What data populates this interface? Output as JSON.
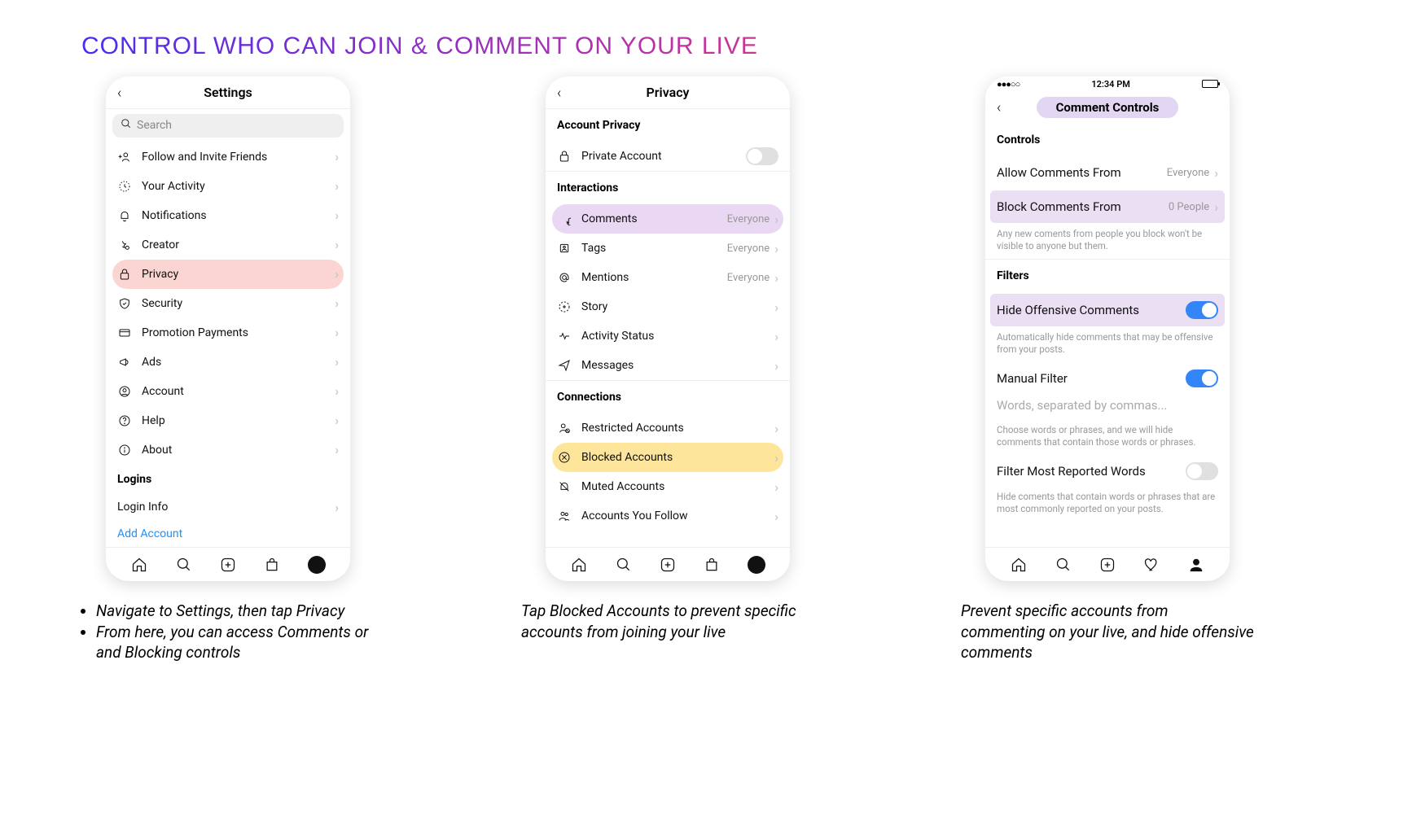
{
  "heading": "CONTROL WHO CAN JOIN & COMMENT ON YOUR LIVE",
  "phone1": {
    "title": "Settings",
    "search_placeholder": "Search",
    "items": [
      {
        "label": "Follow and Invite Friends",
        "icon": "person-plus"
      },
      {
        "label": "Your Activity",
        "icon": "activity"
      },
      {
        "label": "Notifications",
        "icon": "bell"
      },
      {
        "label": "Creator",
        "icon": "star-gear"
      },
      {
        "label": "Privacy",
        "icon": "lock",
        "highlight": "pink"
      },
      {
        "label": "Security",
        "icon": "shield"
      },
      {
        "label": "Promotion Payments",
        "icon": "card"
      },
      {
        "label": "Ads",
        "icon": "megaphone"
      },
      {
        "label": "Account",
        "icon": "user-circle"
      },
      {
        "label": "Help",
        "icon": "help"
      },
      {
        "label": "About",
        "icon": "info"
      }
    ],
    "logins_header": "Logins",
    "login_info": "Login Info",
    "add_account": "Add Account"
  },
  "phone1_caption_items": [
    "Navigate to Settings, then tap Privacy",
    "From here, you can access Comments or and Blocking controls"
  ],
  "phone2": {
    "title": "Privacy",
    "section1": "Account Privacy",
    "private_account": "Private Account",
    "section2": "Interactions",
    "interactions": [
      {
        "label": "Comments",
        "meta": "Everyone",
        "icon": "comment",
        "highlight": "violet"
      },
      {
        "label": "Tags",
        "meta": "Everyone",
        "icon": "tag"
      },
      {
        "label": "Mentions",
        "meta": "Everyone",
        "icon": "at"
      },
      {
        "label": "Story",
        "icon": "story"
      },
      {
        "label": "Activity Status",
        "icon": "pulse"
      },
      {
        "label": "Messages",
        "icon": "send"
      }
    ],
    "section3": "Connections",
    "connections": [
      {
        "label": "Restricted Accounts",
        "icon": "restrict"
      },
      {
        "label": "Blocked Accounts",
        "icon": "block",
        "highlight": "yellow"
      },
      {
        "label": "Muted Accounts",
        "icon": "mute"
      },
      {
        "label": "Accounts You Follow",
        "icon": "follow"
      }
    ]
  },
  "phone2_caption": "Tap Blocked Accounts to prevent specific accounts from joining your live",
  "phone3": {
    "status_time": "12:34 PM",
    "title": "Comment Controls",
    "controls_header": "Controls",
    "allow_label": "Allow Comments From",
    "allow_value": "Everyone",
    "block_label": "Block Comments From",
    "block_value": "0 People",
    "block_sub": "Any new coments from people you block won't be visible to anyone but them.",
    "filters_header": "Filters",
    "hide_offensive": "Hide Offensive Comments",
    "hide_sub": "Automatically hide comments that may be offensive from your posts.",
    "manual": "Manual Filter",
    "manual_placeholder": "Words, separated by commas...",
    "manual_sub": "Choose words or phrases, and we will hide comments that contain those words or phrases.",
    "most_reported": "Filter Most Reported Words",
    "most_reported_sub": "Hide coments that contain words or phrases that are most commonly reported on your posts."
  },
  "phone3_caption": "Prevent specific accounts from commenting on your live, and hide offensive comments"
}
